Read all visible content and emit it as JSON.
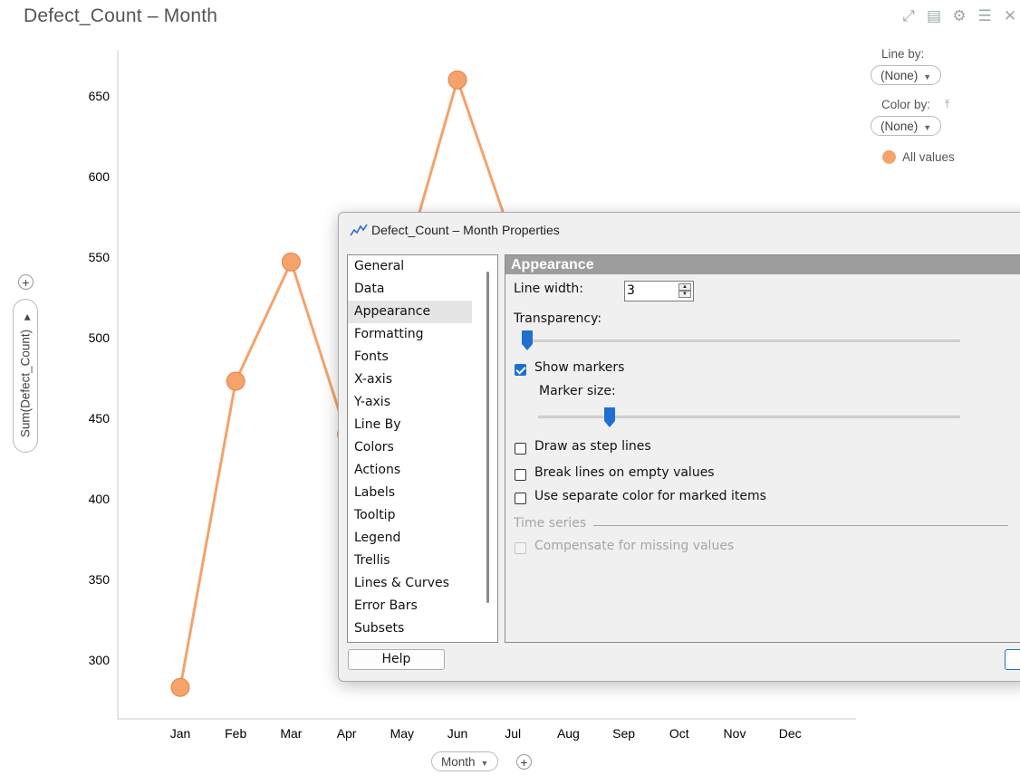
{
  "visualization": {
    "title": "Defect_Count – Month",
    "toolbar_icons": [
      "expand-icon",
      "export-icon",
      "settings-icon",
      "menu-icon",
      "close-icon"
    ],
    "y_axis_selector": "Sum(Defect_Count)",
    "x_axis_selector": "Month",
    "line_by": {
      "label": "Line by:",
      "value": "(None)"
    },
    "color_by": {
      "label": "Color by:",
      "value": "(None)"
    },
    "legend_item": "All values",
    "marker_color": "#F5A26B",
    "line_color": "#F5A26B"
  },
  "chart_data": {
    "type": "line",
    "categories": [
      "Jan",
      "Feb",
      "Mar",
      "Apr",
      "May",
      "Jun",
      "Jul",
      "Aug",
      "Sep",
      "Oct",
      "Nov",
      "Dec"
    ],
    "series": [
      {
        "values": [
          283,
          473,
          547,
          440,
          540,
          660,
          560,
          null,
          null,
          null,
          null,
          null
        ]
      }
    ],
    "yticks": [
      300,
      350,
      400,
      450,
      500,
      550,
      600,
      650
    ],
    "ylim": [
      265,
      680
    ],
    "xlabel": "Month",
    "ylabel": "Sum(Defect_Count)",
    "grid": false
  },
  "dialog": {
    "title": "Defect_Count – Month Properties",
    "nav_items": [
      "General",
      "Data",
      "Appearance",
      "Formatting",
      "Fonts",
      "X-axis",
      "Y-axis",
      "Line By",
      "Colors",
      "Actions",
      "Labels",
      "Tooltip",
      "Legend",
      "Trellis",
      "Lines & Curves",
      "Error Bars",
      "Subsets"
    ],
    "selected_nav": "Appearance",
    "section_header": "Appearance",
    "line_width_label": "Line width:",
    "line_width_value": "3",
    "transparency_label": "Transparency:",
    "transparency_value": 0.0,
    "show_markers_label": "Show markers",
    "show_markers_checked": true,
    "marker_size_label": "Marker size:",
    "marker_size_value": 0.17,
    "step_lines_label": "Draw as step lines",
    "break_lines_label": "Break lines on empty values",
    "separate_color_label": "Use separate color for marked items",
    "time_series_label": "Time series",
    "compensate_label": "Compensate for missing values",
    "help_label": "Help",
    "accent_color": "#1F6FD1"
  }
}
